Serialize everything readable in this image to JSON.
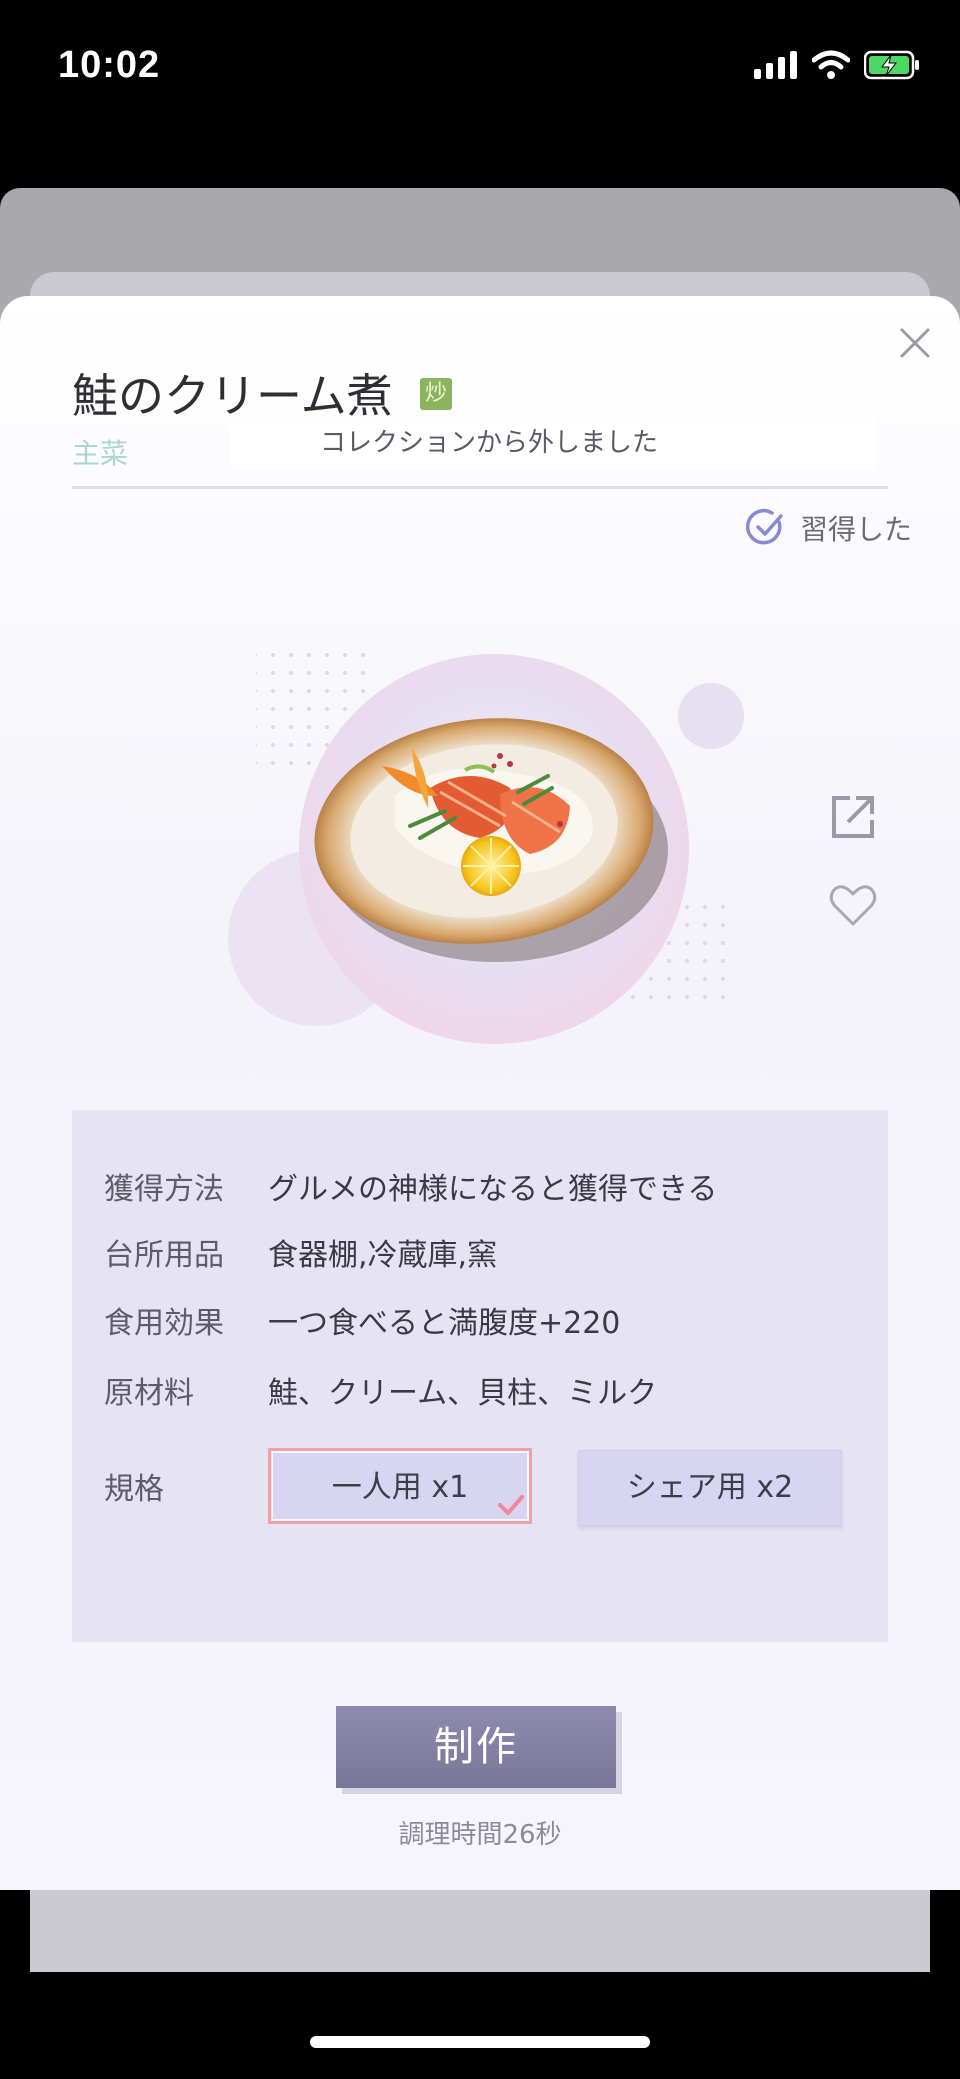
{
  "status_bar": {
    "time": "10:02"
  },
  "dish": {
    "title": "鮭のクリーム煮",
    "method_tag": "炒",
    "category": "主菜"
  },
  "toast": "コレクションから外しました",
  "learned_label": "習得した",
  "info": {
    "rows": [
      {
        "label": "獲得方法",
        "value": "グルメの神様になると獲得できる"
      },
      {
        "label": "台所用品",
        "value": "食器棚,冷蔵庫,窯"
      },
      {
        "label": "食用効果",
        "value": "一つ食べると満腹度+220"
      },
      {
        "label": "原材料",
        "value": "鮭、クリーム、貝柱、ミルク"
      }
    ],
    "spec_label": "規格",
    "spec_options": [
      {
        "label": "一人用 x1",
        "selected": true
      },
      {
        "label": "シェア用 x2",
        "selected": false
      }
    ]
  },
  "make_button": "制作",
  "cook_time": "調理時間26秒",
  "icons": {
    "close": "close-icon",
    "learned": "check-circle-icon",
    "share": "share-icon",
    "favorite": "heart-icon"
  },
  "colors": {
    "accent_pink": "#f2a0a8",
    "panel": "#e6e4f3",
    "tag_green": "#8cb35e",
    "button": "#7a7699"
  }
}
